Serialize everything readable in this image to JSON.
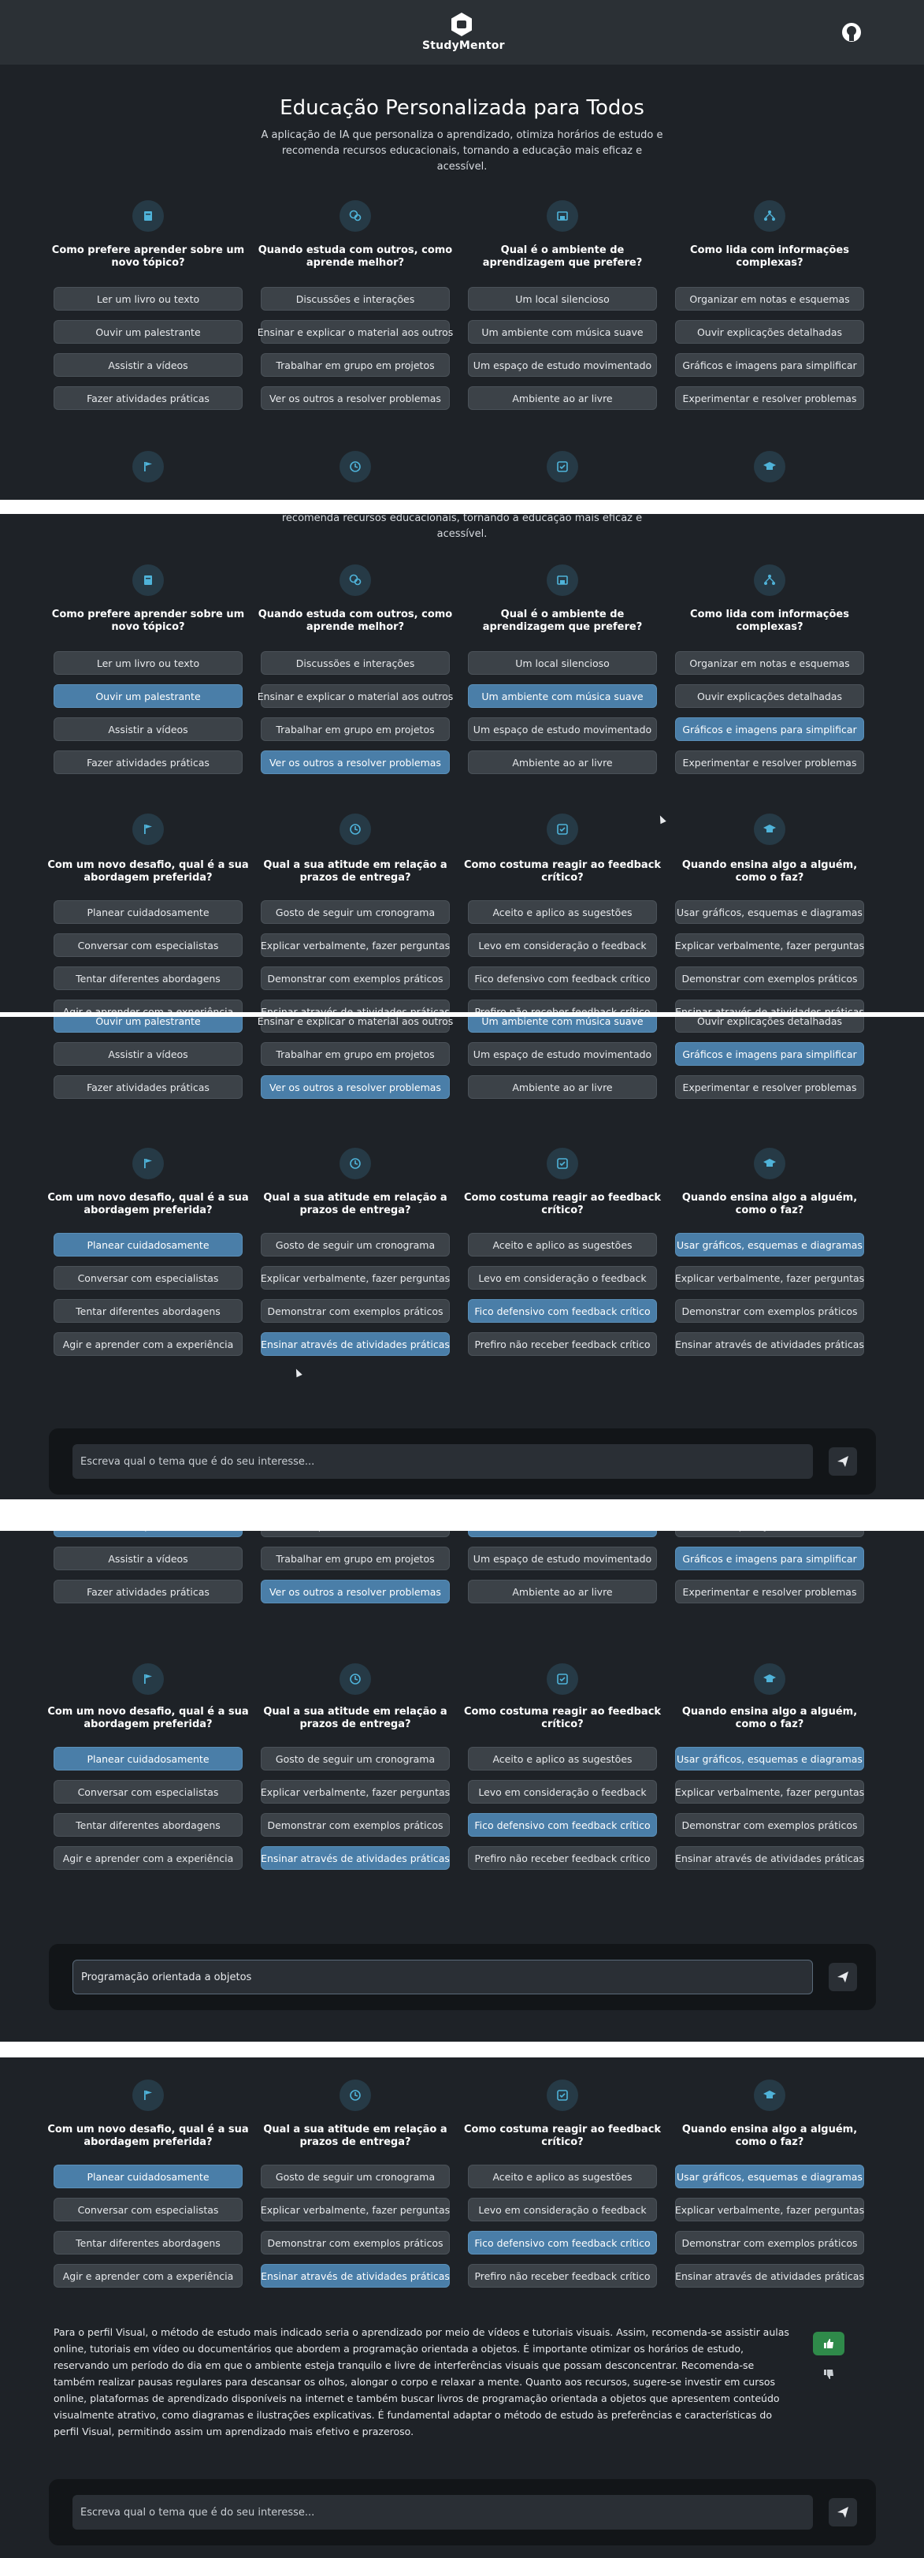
{
  "app": {
    "name": "StudyMentor"
  },
  "hero": {
    "title": "Educação Personalizada para Todos",
    "subtitle": "A aplicação de IA que personaliza o aprendizado, otimiza horários de estudo e recomenda recursos educacionais, tornando a educação mais eficaz e acessível.",
    "subtitle_clipped": "recomenda recursos educacionais, tornando a educação mais eficaz e acessível."
  },
  "questions_row1": [
    {
      "icon": "book-icon",
      "title": "Como prefere aprender sobre um novo tópico?",
      "options": [
        "Ler um livro ou texto",
        "Ouvir um palestrante",
        "Assistir a vídeos",
        "Fazer atividades práticas"
      ]
    },
    {
      "icon": "chat-icon",
      "title": "Quando estuda com outros, como aprende melhor?",
      "options": [
        "Discussões e interações",
        "Ensinar e explicar o material aos outros",
        "Trabalhar em grupo em projetos",
        "Ver os outros a resolver problemas"
      ]
    },
    {
      "icon": "room-icon",
      "title": "Qual é o ambiente de aprendizagem que prefere?",
      "options": [
        "Um local silencioso",
        "Um ambiente com música suave",
        "Um espaço de estudo movimentado",
        "Ambiente ao ar livre"
      ]
    },
    {
      "icon": "hierarchy-icon",
      "title": "Como lida com informações complexas?",
      "options": [
        "Organizar em notas e esquemas",
        "Ouvir explicações detalhadas",
        "Gráficos e imagens para simplificar",
        "Experimentar e resolver problemas"
      ]
    }
  ],
  "questions_row2": [
    {
      "icon": "flag-icon",
      "title": "Com um novo desafio, qual é a sua abordagem preferida?",
      "options": [
        "Planear cuidadosamente",
        "Conversar com especialistas",
        "Tentar diferentes abordagens",
        "Agir e aprender com a experiência"
      ]
    },
    {
      "icon": "clock-icon",
      "title": "Qual a sua atitude em relação a prazos de entrega?",
      "options": [
        "Gosto de seguir um cronograma",
        "Explicar verbalmente, fazer perguntas",
        "Demonstrar com exemplos práticos",
        "Ensinar através de atividades práticas"
      ]
    },
    {
      "icon": "check-box-icon",
      "title": "Como costuma reagir ao feedback crítico?",
      "options": [
        "Aceito e aplico as sugestões",
        "Levo em consideração o feedback",
        "Fico defensivo com feedback crítico",
        "Prefiro não receber feedback crítico"
      ]
    },
    {
      "icon": "graduation-cap-icon",
      "title": "Quando ensina algo a alguém, como o faz?",
      "options": [
        "Usar gráficos, esquemas e diagramas",
        "Explicar verbalmente, fazer perguntas",
        "Demonstrar com exemplos práticos",
        "Ensinar através de atividades práticas"
      ]
    }
  ],
  "input": {
    "placeholder": "Escreva qual o tema que é do seu interesse...",
    "typed_value": "Programação orientada a objetos"
  },
  "result": {
    "text": "Para o perfil Visual, o método de estudo mais indicado seria o aprendizado por meio de vídeos e tutoriais visuais. Assim, recomenda-se assistir aulas online, tutoriais em vídeo ou documentários que abordem a programação orientada a objetos. É importante otimizar os horários de estudo, reservando um período do dia em que o ambiente esteja tranquilo e livre de interferências visuais que possam desconcentrar. Recomenda-se também realizar pausas regulares para descansar os olhos, alongar o corpo e relaxar a mente. Quanto aos recursos, sugere-se investir em cursos online, plataformas de aprendizado disponíveis na internet e também buscar livros de programação orientada a objetos que apresentem conteúdo visualmente atrativo, como diagramas e ilustrações explicativas. É fundamental adaptar o método de estudo às preferências e características do perfil Visual, permitindo assim um aprendizado mais efetivo e prazeroso."
  },
  "colors": {
    "background": "#1e2227",
    "topbar": "#2b3035",
    "option": "#3c4248",
    "selected": "#4a7ea8",
    "accent_icon": "#4fb3d9",
    "thumb_up": "#2f8a4a"
  }
}
